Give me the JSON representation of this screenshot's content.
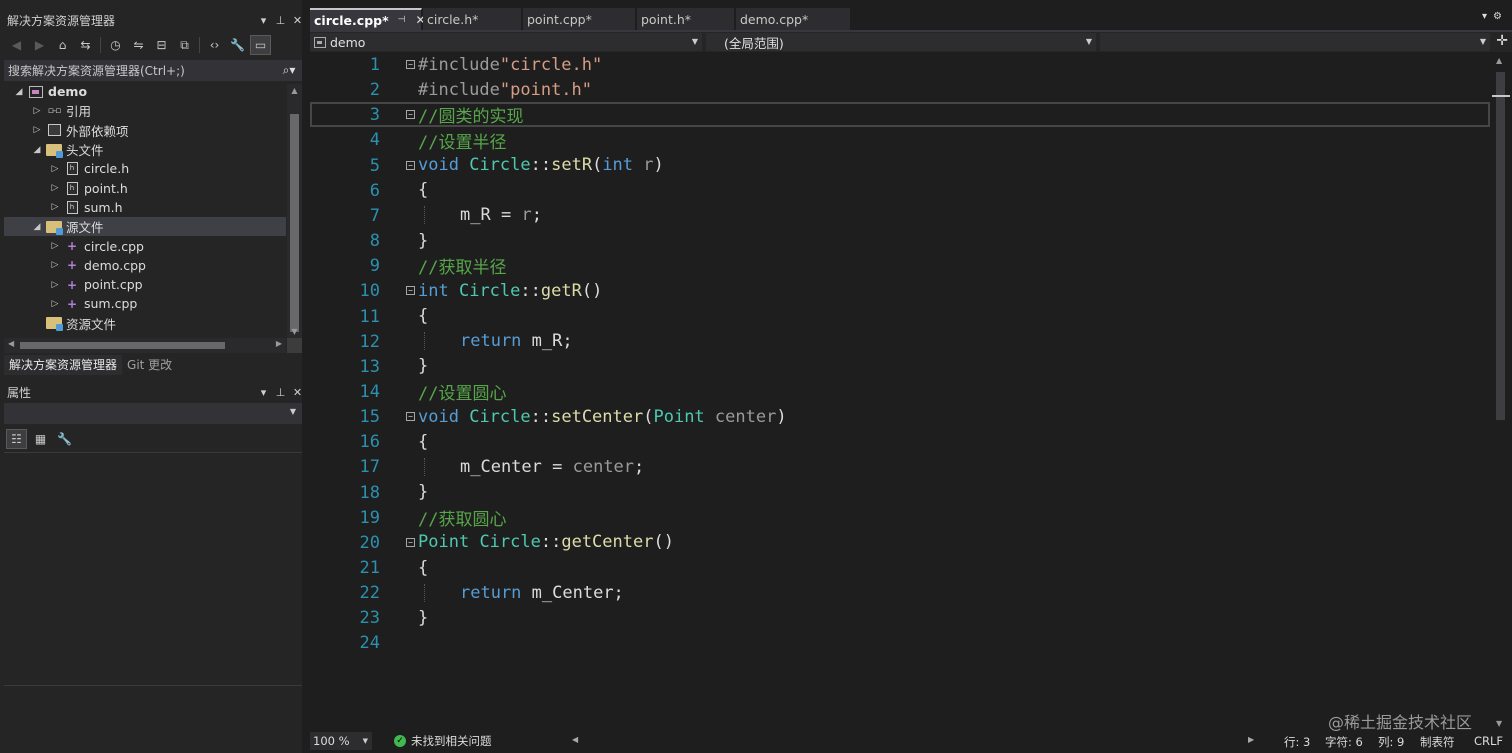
{
  "solution_explorer": {
    "title": "解决方案资源管理器",
    "pin": "🖈",
    "close": "✕",
    "dropdown": "▾",
    "search_placeholder": "搜索解决方案资源管理器(Ctrl+;)",
    "tree": [
      {
        "label": "demo",
        "icon": "solution-icon",
        "arrow": "◢",
        "indent": 0,
        "bold": true
      },
      {
        "label": "引用",
        "icon": "reference-icon",
        "arrow": "▷",
        "indent": 1
      },
      {
        "label": "外部依赖项",
        "icon": "dependencies-icon",
        "arrow": "▷",
        "indent": 1
      },
      {
        "label": "头文件",
        "icon": "folder-icon",
        "arrow": "◢",
        "indent": 1
      },
      {
        "label": "circle.h",
        "icon": "header-file-icon",
        "arrow": "▷",
        "indent": 2
      },
      {
        "label": "point.h",
        "icon": "header-file-icon",
        "arrow": "▷",
        "indent": 2
      },
      {
        "label": "sum.h",
        "icon": "header-file-icon",
        "arrow": "▷",
        "indent": 2
      },
      {
        "label": "源文件",
        "icon": "folder-icon",
        "arrow": "◢",
        "indent": 1,
        "selected": true
      },
      {
        "label": "circle.cpp",
        "icon": "cpp-file-icon",
        "arrow": "▷",
        "indent": 2
      },
      {
        "label": "demo.cpp",
        "icon": "cpp-file-icon",
        "arrow": "▷",
        "indent": 2
      },
      {
        "label": "point.cpp",
        "icon": "cpp-file-icon",
        "arrow": "▷",
        "indent": 2
      },
      {
        "label": "sum.cpp",
        "icon": "cpp-file-icon",
        "arrow": "▷",
        "indent": 2
      },
      {
        "label": "资源文件",
        "icon": "folder-icon",
        "arrow": "",
        "indent": 1
      }
    ],
    "bottom_tabs": [
      "解决方案资源管理器",
      "Git 更改"
    ]
  },
  "properties": {
    "title": "属性"
  },
  "editor": {
    "tabs": [
      {
        "label": "circle.cpp*",
        "active": true
      },
      {
        "label": "circle.h*"
      },
      {
        "label": "point.cpp*"
      },
      {
        "label": "point.h*"
      },
      {
        "label": "demo.cpp*"
      }
    ],
    "nav_project": "demo",
    "nav_scope": "(全局范围)",
    "line_numbers": [
      "1",
      "2",
      "3",
      "4",
      "5",
      "6",
      "7",
      "8",
      "9",
      "10",
      "11",
      "12",
      "13",
      "14",
      "15",
      "16",
      "17",
      "18",
      "19",
      "20",
      "21",
      "22",
      "23",
      "24"
    ],
    "current_line": 3,
    "code": {
      "l1_a": "#include",
      "l1_b": "\"circle.h\"",
      "l2_a": "#include",
      "l2_b": "\"point.h\"",
      "l3": "//圆类的实现",
      "l4": "//设置半径",
      "l5_kw": "void",
      "l5_cls": "Circle",
      "l5_sep": "::",
      "l5_fn": "setR",
      "l5_open": "(",
      "l5_ptype": "int",
      "l5_pname": "r",
      "l5_close": ")",
      "l6": "{",
      "l7_mb": "m_R",
      "l7_op": " = ",
      "l7_pa": "r",
      "l7_end": ";",
      "l8": "}",
      "l9": "//获取半径",
      "l10_kw": "int",
      "l10_cls": "Circle",
      "l10_sep": "::",
      "l10_fn": "getR",
      "l10_paren": "()",
      "l11": "{",
      "l12_kw": "return",
      "l12_rest": "m_R;",
      "l13": "}",
      "l14": "//设置圆心",
      "l15_kw": "void",
      "l15_cls": "Circle",
      "l15_sep": "::",
      "l15_fn": "setCenter",
      "l15_open": "(",
      "l15_ptype": "Point",
      "l15_pname": "center",
      "l15_close": ")",
      "l16": "{",
      "l17_mb": "m_Center",
      "l17_op": " = ",
      "l17_pa": "center",
      "l17_end": ";",
      "l18": "}",
      "l19": "//获取圆心",
      "l20_ty": "Point",
      "l20_cls": "Circle",
      "l20_sep": "::",
      "l20_fn": "getCenter",
      "l20_paren": "()",
      "l21": "{",
      "l22_kw": "return",
      "l22_rest": "m_Center;",
      "l23": "}"
    }
  },
  "status": {
    "zoom": "100 %",
    "issues": "未找到相关问题",
    "line": "行: 3",
    "char": "字符: 6",
    "col": "列: 9",
    "tabs": "制表符",
    "eol": "CRLF"
  },
  "watermark": "@稀土掘金技术社区",
  "colors": {
    "keyword": "#569cd6",
    "type": "#4ec9b0",
    "function": "#dcdcaa",
    "comment": "#57a64a",
    "string": "#d69d85",
    "line_number": "#2b91af",
    "change_bar": "#d7ba7d"
  }
}
